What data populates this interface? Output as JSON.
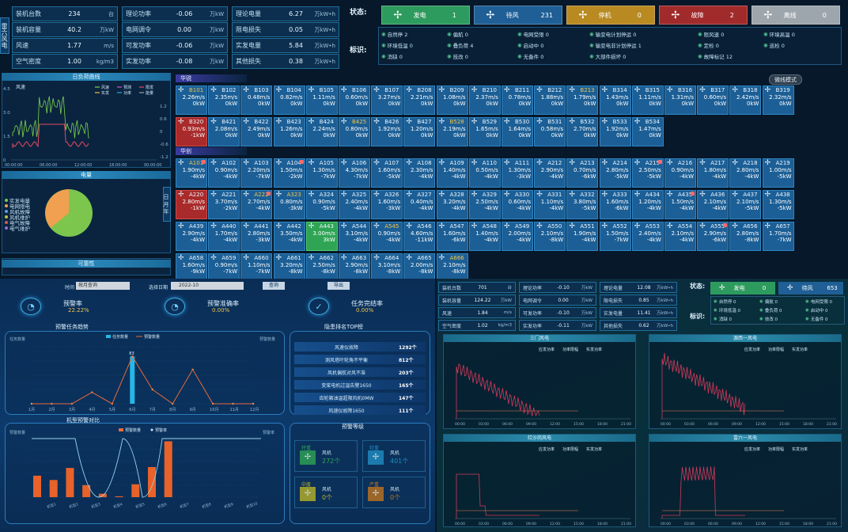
{
  "side_tab": "雷六风电",
  "stats_top": [
    {
      "label": "装机台数",
      "value": "234",
      "unit": "台"
    },
    {
      "label": "理论功率",
      "value": "-0.06",
      "unit": "万kW"
    },
    {
      "label": "理论电量",
      "value": "6.27",
      "unit": "万kW•h"
    },
    {
      "label": "装机容量",
      "value": "40.2",
      "unit": "万kW"
    },
    {
      "label": "电网调令",
      "value": "0.00",
      "unit": "万kW"
    },
    {
      "label": "限电损失",
      "value": "0.05",
      "unit": "万kW•h"
    },
    {
      "label": "风速",
      "value": "1.77",
      "unit": "m/s"
    },
    {
      "label": "可发功率",
      "value": "-0.06",
      "unit": "万kW"
    },
    {
      "label": "实发电量",
      "value": "5.84",
      "unit": "万kW•h"
    },
    {
      "label": "空气密度",
      "value": "1.00",
      "unit": "kg/m3"
    },
    {
      "label": "实发功率",
      "value": "-0.08",
      "unit": "万kW"
    },
    {
      "label": "其他损失",
      "value": "0.38",
      "unit": "万kW•h"
    }
  ],
  "status": {
    "label": "状态:",
    "boxes": [
      {
        "name": "发电",
        "count": "1",
        "color": "#2e9b5e",
        "icon": "turbine-icon"
      },
      {
        "name": "待风",
        "count": "231",
        "color": "#1f5f96",
        "icon": "turbine-icon"
      },
      {
        "name": "停机",
        "count": "0",
        "color": "#b98a22",
        "icon": "turbine-icon"
      },
      {
        "name": "故障",
        "count": "2",
        "color": "#a12a2a",
        "icon": "turbine-icon"
      },
      {
        "name": "离线",
        "count": "0",
        "color": "#9ea6ad",
        "icon": "turbine-icon"
      }
    ]
  },
  "marks": {
    "label": "标识:",
    "items": [
      [
        "自然停 2",
        "偏航 0",
        "电网受限 0",
        "输变电计划停运 0",
        "限风速 0",
        "环境高温 0"
      ],
      [
        "环境低温 0",
        "叠负荷 4",
        "启动中 0",
        "输变电非计划停运 1",
        "定检 0",
        "巡检 0"
      ],
      [
        "消缺 0",
        "技改 0",
        "无备件 0",
        "大部件损坏 0",
        "故障标记 12",
        ""
      ]
    ]
  },
  "power_curve": {
    "title": "日负荷曲线",
    "y_left": "风速",
    "legend": [
      "风速",
      "预测",
      "限发",
      "实发",
      "功率",
      "能量"
    ],
    "left_ticks": [
      "4.5",
      "3.0",
      "1.5",
      "0"
    ],
    "right_ticks": [
      "1.2",
      "0.6",
      "0",
      "-0.6",
      "-1.2"
    ],
    "x_ticks": [
      "00:00:00",
      "06:00:00",
      "12:00:00",
      "18:00:00",
      "00:00:00"
    ]
  },
  "pie": {
    "title": "电量",
    "legend": [
      "实发电量",
      "电网限电",
      "风机故障",
      "风机维护",
      "电气故障",
      "电气维护"
    ],
    "side_label": "日 月 年"
  },
  "avail": {
    "title": "可靠性"
  },
  "groups": [
    {
      "name": "华锐",
      "mode_button": "微线模式",
      "cells": [
        {
          "id": "B101",
          "s": "2.26m/s",
          "p": "0kW",
          "c": "warn"
        },
        {
          "id": "B102",
          "s": "2.35m/s",
          "p": "0kW"
        },
        {
          "id": "B103",
          "s": "0.48m/s",
          "p": "0kW"
        },
        {
          "id": "B104",
          "s": "0.82m/s",
          "p": "0kW"
        },
        {
          "id": "B105",
          "s": "1.11m/s",
          "p": "0kW"
        },
        {
          "id": "B106",
          "s": "0.60m/s",
          "p": "0kW"
        },
        {
          "id": "B107",
          "s": "3.27m/s",
          "p": "0kW"
        },
        {
          "id": "B208",
          "s": "2.21m/s",
          "p": "0kW"
        },
        {
          "id": "B209",
          "s": "1.08m/s",
          "p": "0kW"
        },
        {
          "id": "B210",
          "s": "2.37m/s",
          "p": "0kW"
        },
        {
          "id": "B211",
          "s": "0.78m/s",
          "p": "0kW"
        },
        {
          "id": "B212",
          "s": "1.88m/s",
          "p": "0kW"
        },
        {
          "id": "B213",
          "s": "1.79m/s",
          "p": "0kW",
          "c": "warn"
        },
        {
          "id": "B314",
          "s": "1.43m/s",
          "p": "0kW"
        },
        {
          "id": "B315",
          "s": "1.11m/s",
          "p": "0kW"
        },
        {
          "id": "B316",
          "s": "1.31m/s",
          "p": "0kW"
        },
        {
          "id": "B317",
          "s": "0.60m/s",
          "p": "0kW"
        },
        {
          "id": "B318",
          "s": "2.42m/s",
          "p": "0kW"
        },
        {
          "id": "B319",
          "s": "2.32m/s",
          "p": "0kW"
        },
        {
          "id": "B320",
          "s": "0.93m/s",
          "p": "-1kW",
          "c": "red"
        },
        {
          "id": "B421",
          "s": "2.08m/s",
          "p": "0kW"
        },
        {
          "id": "B422",
          "s": "2.49m/s",
          "p": "0kW"
        },
        {
          "id": "B423",
          "s": "1.26m/s",
          "p": "0kW"
        },
        {
          "id": "B424",
          "s": "2.24m/s",
          "p": "0kW"
        },
        {
          "id": "B425",
          "s": "0.80m/s",
          "p": "0kW",
          "c": "warn"
        },
        {
          "id": "B426",
          "s": "1.92m/s",
          "p": "0kW"
        },
        {
          "id": "B427",
          "s": "1.20m/s",
          "p": "0kW"
        },
        {
          "id": "B528",
          "s": "2.19m/s",
          "p": "0kW",
          "c": "warn"
        },
        {
          "id": "B529",
          "s": "1.65m/s",
          "p": "0kW"
        },
        {
          "id": "B530",
          "s": "1.64m/s",
          "p": "0kW"
        },
        {
          "id": "B531",
          "s": "0.58m/s",
          "p": "0kW"
        },
        {
          "id": "B532",
          "s": "2.70m/s",
          "p": "0kW"
        },
        {
          "id": "B533",
          "s": "1.92m/s",
          "p": "0kW"
        },
        {
          "id": "B534",
          "s": "1.47m/s",
          "p": "0kW"
        }
      ]
    },
    {
      "name": "华创",
      "cells": [
        {
          "id": "A101",
          "s": "1.90m/s",
          "p": "-4kW",
          "c": "warn",
          "dot": true
        },
        {
          "id": "A102",
          "s": "0.90m/s",
          "p": "-4kW"
        },
        {
          "id": "A103",
          "s": "2.20m/s",
          "p": "-7kW"
        },
        {
          "id": "A104",
          "s": "1.50m/s",
          "p": "-2kW",
          "dot": true
        },
        {
          "id": "A105",
          "s": "1.30m/s",
          "p": "-7kW"
        },
        {
          "id": "A106",
          "s": "4.30m/s",
          "p": "-7kW"
        },
        {
          "id": "A107",
          "s": "1.60m/s",
          "p": "-5kW"
        },
        {
          "id": "A108",
          "s": "2.30m/s",
          "p": "-4kW"
        },
        {
          "id": "A109",
          "s": "1.40m/s",
          "p": "-4kW"
        },
        {
          "id": "A110",
          "s": "0.50m/s",
          "p": "-4kW"
        },
        {
          "id": "A111",
          "s": "1.30m/s",
          "p": "-3kW"
        },
        {
          "id": "A212",
          "s": "2.90m/s",
          "p": "-4kW"
        },
        {
          "id": "A213",
          "s": "0.70m/s",
          "p": "-6kW"
        },
        {
          "id": "A214",
          "s": "2.80m/s",
          "p": "-5kW"
        },
        {
          "id": "A215",
          "s": "2.50m/s",
          "p": "-5kW",
          "dot": true
        },
        {
          "id": "A216",
          "s": "0.90m/s",
          "p": "-4kW"
        },
        {
          "id": "A217",
          "s": "1.80m/s",
          "p": "-4kW"
        },
        {
          "id": "A218",
          "s": "2.80m/s",
          "p": "-4kW"
        },
        {
          "id": "A219",
          "s": "1.00m/s",
          "p": "-5kW"
        },
        {
          "id": "A220",
          "s": "2.80m/s",
          "p": "-1kW",
          "c": "red"
        },
        {
          "id": "A221",
          "s": "3.70m/s",
          "p": "-2kW"
        },
        {
          "id": "A222",
          "s": "2.70m/s",
          "p": "-4kW",
          "c": "warn",
          "dot": true
        },
        {
          "id": "A323",
          "s": "0.80m/s",
          "p": "-3kW",
          "c": "warn"
        },
        {
          "id": "A324",
          "s": "0.90m/s",
          "p": "-5kW"
        },
        {
          "id": "A325",
          "s": "2.40m/s",
          "p": "-4kW"
        },
        {
          "id": "A326",
          "s": "1.60m/s",
          "p": "-3kW"
        },
        {
          "id": "A327",
          "s": "0.40m/s",
          "p": "-4kW"
        },
        {
          "id": "A328",
          "s": "3.20m/s",
          "p": "-4kW"
        },
        {
          "id": "A329",
          "s": "2.50m/s",
          "p": "-4kW"
        },
        {
          "id": "A330",
          "s": "0.60m/s",
          "p": "-4kW"
        },
        {
          "id": "A331",
          "s": "1.10m/s",
          "p": "-4kW"
        },
        {
          "id": "A332",
          "s": "3.80m/s",
          "p": "-5kW"
        },
        {
          "id": "A333",
          "s": "1.60m/s",
          "p": "-6kW"
        },
        {
          "id": "A434",
          "s": "1.20m/s",
          "p": "-4kW"
        },
        {
          "id": "A435",
          "s": "1.50m/s",
          "p": "-4kW",
          "dot": true
        },
        {
          "id": "A436",
          "s": "2.10m/s",
          "p": "-4kW"
        },
        {
          "id": "A437",
          "s": "2.10m/s",
          "p": "-5kW"
        },
        {
          "id": "A438",
          "s": "1.30m/s",
          "p": "-5kW"
        },
        {
          "id": "A439",
          "s": "2.90m/s",
          "p": "-4kW"
        },
        {
          "id": "A440",
          "s": "1.70m/s",
          "p": "-4kW"
        },
        {
          "id": "A441",
          "s": "2.80m/s",
          "p": "-3kW"
        },
        {
          "id": "A442",
          "s": "3.50m/s",
          "p": "-4kW"
        },
        {
          "id": "A443",
          "s": "3.00m/s",
          "p": "3kW",
          "c": "green"
        },
        {
          "id": "A544",
          "s": "3.10m/s",
          "p": "-4kW"
        },
        {
          "id": "A545",
          "s": "0.90m/s",
          "p": "-4kW",
          "c": "warn"
        },
        {
          "id": "A546",
          "s": "4.60m/s",
          "p": "-11kW"
        },
        {
          "id": "A547",
          "s": "1.60m/s",
          "p": "-6kW"
        },
        {
          "id": "A548",
          "s": "1.40m/s",
          "p": "-4kW"
        },
        {
          "id": "A549",
          "s": "2.00m/s",
          "p": "-4kW"
        },
        {
          "id": "A550",
          "s": "2.10m/s",
          "p": "-8kW"
        },
        {
          "id": "A551",
          "s": "1.90m/s",
          "p": "-4kW"
        },
        {
          "id": "A552",
          "s": "1.50m/s",
          "p": "-7kW"
        },
        {
          "id": "A553",
          "s": "2.40m/s",
          "p": "-4kW"
        },
        {
          "id": "A554",
          "s": "2.10m/s",
          "p": "-4kW"
        },
        {
          "id": "A555",
          "s": "2.90m/s",
          "p": "-6kW",
          "dot": true
        },
        {
          "id": "A656",
          "s": "2.80m/s",
          "p": "-8kW"
        },
        {
          "id": "A657",
          "s": "1.70m/s",
          "p": "-7kW"
        },
        {
          "id": "A658",
          "s": "1.60m/s",
          "p": "-9kW"
        },
        {
          "id": "A659",
          "s": "0.90m/s",
          "p": "-7kW"
        },
        {
          "id": "A660",
          "s": "1.10m/s",
          "p": "-7kW"
        },
        {
          "id": "A661",
          "s": "3.20m/s",
          "p": "-8kW"
        },
        {
          "id": "A662",
          "s": "2.50m/s",
          "p": "-8kW"
        },
        {
          "id": "A663",
          "s": "2.90m/s",
          "p": "-8kW"
        },
        {
          "id": "A664",
          "s": "3.10m/s",
          "p": "-8kW"
        },
        {
          "id": "A665",
          "s": "2.00m/s",
          "p": "-8kW"
        },
        {
          "id": "A666",
          "s": "2.10m/s",
          "p": "-8kW",
          "c": "warn"
        }
      ]
    }
  ],
  "lower_left": {
    "filter": {
      "time_label": "时间",
      "period": "按月查询",
      "select_label": "选择日期",
      "date": "2022-10",
      "query_button": "查询",
      "export_button": "导出"
    },
    "kpis": [
      {
        "title": "预警率",
        "value": "22.22%"
      },
      {
        "title": "预警准确率",
        "value": "0.00%"
      },
      {
        "title": "任务完结率",
        "value": "0.00%"
      }
    ],
    "trend_title": "预警任务趋势",
    "trend_legend": [
      "任务数量",
      "预警数量"
    ],
    "trend_x": [
      "1月",
      "2月",
      "3月",
      "4月",
      "5月",
      "6月",
      "7月",
      "8月",
      "9月",
      "10月",
      "11月",
      "12月"
    ],
    "trend_left_label": "任务数量",
    "trend_right_label": "预警数量",
    "trend_values_bar": [
      0,
      0,
      0,
      0,
      0,
      0,
      0,
      0,
      0,
      0,
      0,
      0
    ],
    "trend_values_line": [
      0,
      0,
      0,
      0,
      0,
      83,
      0,
      0,
      0,
      0,
      0,
      0
    ],
    "top_title": "隐患排名TOP榜",
    "top_list": [
      {
        "name": "风速仪故障",
        "count": "1292个"
      },
      {
        "name": "测风塔叶轮角不平衡",
        "count": "812个"
      },
      {
        "name": "风机偏航对风不准",
        "count": "203个"
      },
      {
        "name": "变桨电机过温告警1650",
        "count": "165个"
      },
      {
        "name": "齿轮箱油温超限风机0MW",
        "count": "147个"
      },
      {
        "name": "风速仪故障1650",
        "count": "111个"
      }
    ],
    "contrast_title": "机型预警对比",
    "contrast_legend": [
      "预警数量",
      "预警率"
    ],
    "contrast_left": "预警数量",
    "contrast_right": "预警率",
    "contrast_bars": [
      50,
      40,
      68,
      28,
      8,
      2,
      30,
      70,
      130,
      0,
      0,
      0,
      0,
      0
    ],
    "level_title": "预警等级",
    "levels": [
      {
        "name": "特重",
        "label": "风机",
        "count": "272个",
        "color": "#2fa455"
      },
      {
        "name": "较重",
        "label": "风机",
        "count": "401个",
        "color": "#1f8ec4"
      },
      {
        "name": "中度",
        "label": "风机",
        "count": "0个",
        "color": "#b9b227"
      },
      {
        "name": "严重",
        "label": "风机",
        "count": "0个",
        "color": "#c0741e"
      }
    ]
  },
  "lower_right": {
    "stats": [
      {
        "label": "装机台数",
        "value": "701",
        "unit": "台"
      },
      {
        "label": "理论功率",
        "value": "-0.10",
        "unit": "万kW"
      },
      {
        "label": "理论电量",
        "value": "12.08",
        "unit": "万kW•h"
      },
      {
        "label": "装机容量",
        "value": "124.22",
        "unit": "万kW"
      },
      {
        "label": "电网调令",
        "value": "0.00",
        "unit": "万kW"
      },
      {
        "label": "限电损失",
        "value": "0.85",
        "unit": "万kW•h"
      },
      {
        "label": "风速",
        "value": "1.84",
        "unit": "m/s"
      },
      {
        "label": "可发功率",
        "value": "-0.10",
        "unit": "万kW"
      },
      {
        "label": "实发电量",
        "value": "11.41",
        "unit": "万kW•h"
      },
      {
        "label": "空气密度",
        "value": "1.02",
        "unit": "kg/m3"
      },
      {
        "label": "实发功率",
        "value": "-0.11",
        "unit": "万kW"
      },
      {
        "label": "其他损失",
        "value": "0.62",
        "unit": "万kW•h"
      }
    ],
    "status_label": "状态:",
    "status": [
      {
        "name": "发电",
        "count": "0",
        "color": "#2e9b5e"
      },
      {
        "name": "待风",
        "count": "653",
        "color": "#1f5f96"
      }
    ],
    "mark_label": "标识:",
    "marks": [
      [
        "自然停 0",
        "偏航 0",
        "电网受限 0"
      ],
      [
        "环境低温 0",
        "叠负荷 0",
        "启动中 0"
      ],
      [
        "消缺 0",
        "技改 0",
        "无备件 0"
      ]
    ],
    "charts": [
      {
        "title": "三门风电",
        "legend": [
          "应发功率",
          "功率限幅",
          "实发功率"
        ]
      },
      {
        "title": "源西一风电",
        "legend": [
          "应发功率",
          "功率限幅",
          "实发功率"
        ]
      },
      {
        "title": "红沙岗风电",
        "legend": [
          "应发功率",
          "功率限幅",
          "实发功率"
        ]
      },
      {
        "title": "雷六一风电",
        "legend": [
          "应发功率",
          "功率限幅",
          "实发功率"
        ]
      }
    ],
    "chart_x": [
      "00:00",
      "03:00",
      "06:00",
      "09:00",
      "12:00",
      "15:00",
      "18:00",
      "21:00"
    ]
  }
}
